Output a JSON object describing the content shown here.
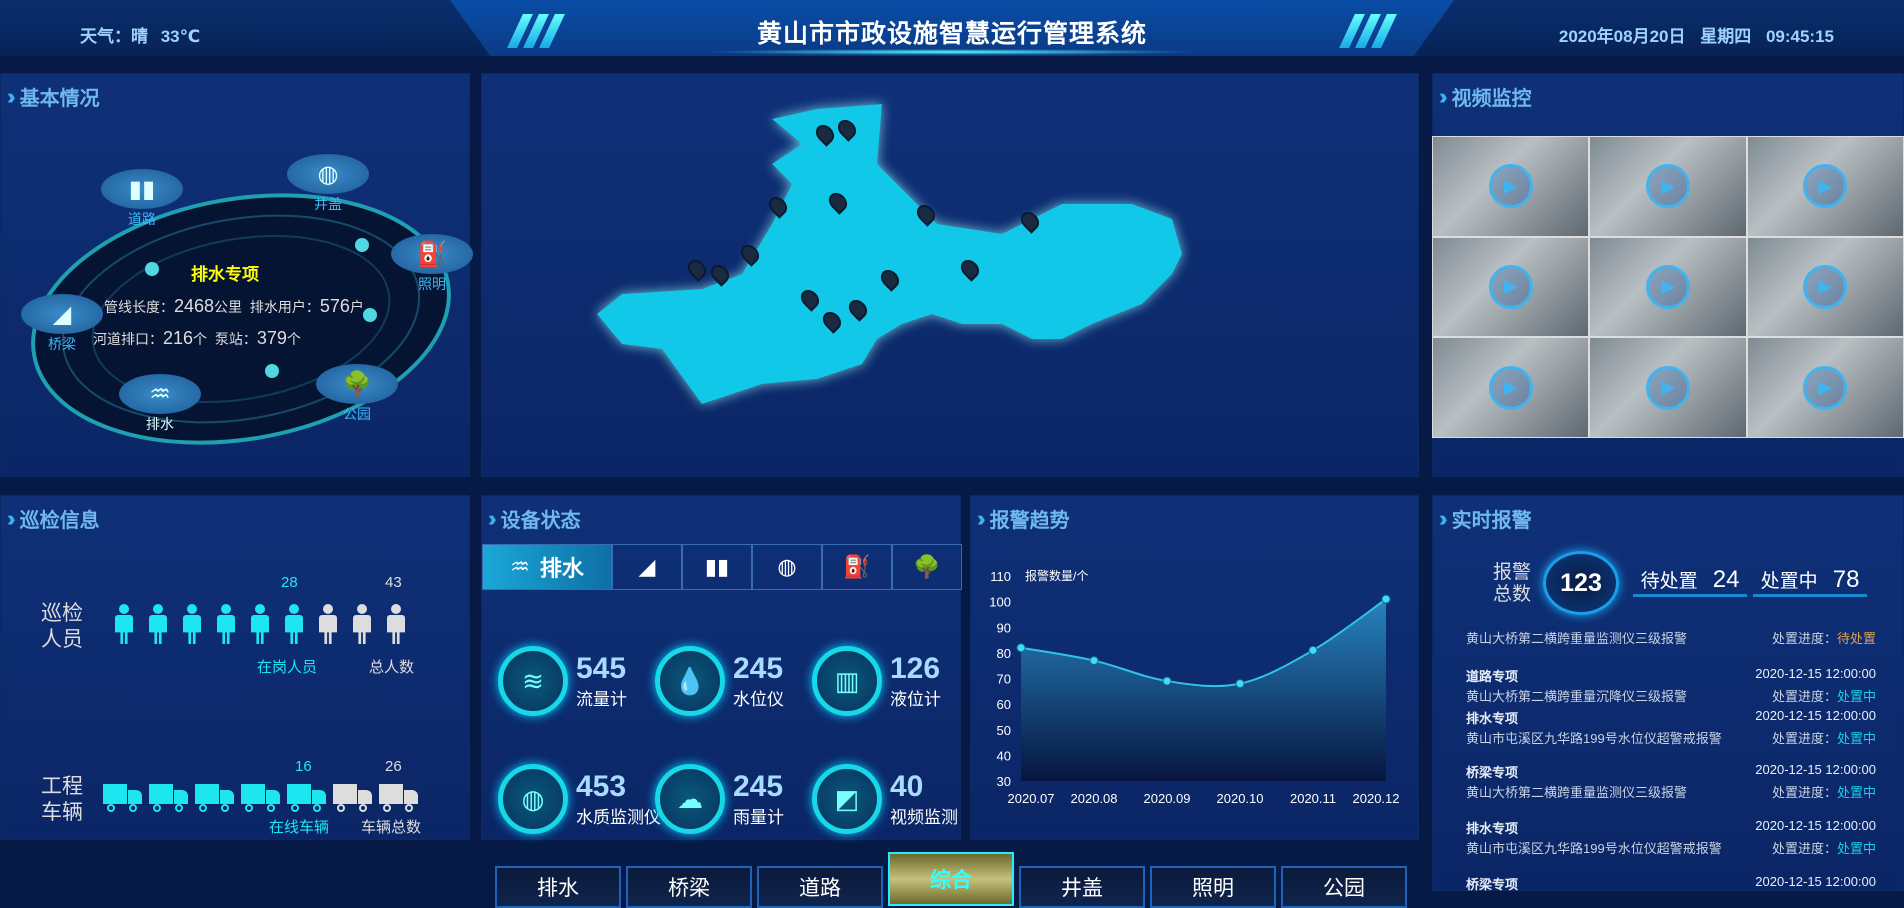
{
  "header": {
    "title": "黄山市市政设施智慧运行管理系统",
    "weather": "天气：晴 33℃",
    "datetime": "2020年08月20日 星期四 09:45:15"
  },
  "basic": {
    "title": "基本情况",
    "center_title": "排水专项",
    "stats": [
      {
        "label": "管线长度：",
        "value": "2468",
        "unit": "公里"
      },
      {
        "label": "排水用户：",
        "value": "576",
        "unit": "户"
      },
      {
        "label": "河道排口：",
        "value": "216",
        "unit": "个"
      },
      {
        "label": "泵站：",
        "value": "379",
        "unit": "个"
      }
    ],
    "nodes": [
      {
        "label": "道路",
        "icon": "road-icon"
      },
      {
        "label": "井盖",
        "icon": "manhole-icon"
      },
      {
        "label": "照明",
        "icon": "streetlight-icon"
      },
      {
        "label": "桥梁",
        "icon": "bridge-icon"
      },
      {
        "label": "排水",
        "icon": "drainage-icon"
      },
      {
        "label": "公园",
        "icon": "park-icon"
      }
    ]
  },
  "video": {
    "title": "视频监控",
    "tiles": 9
  },
  "patrol": {
    "title": "巡检信息",
    "personnel_label": "巡检人员",
    "on_duty": "28",
    "on_duty_label": "在岗人员",
    "total": "43",
    "total_label": "总人数",
    "vehicle_label": "工程车辆",
    "online": "16",
    "online_label": "在线车辆",
    "vehicle_total": "26",
    "vehicle_total_label": "车辆总数"
  },
  "devices": {
    "title": "设备状态",
    "active_tab": "排水",
    "metrics": [
      {
        "value": "545",
        "label": "流量计",
        "icon": "flow-meter-icon",
        "glyph": "≋"
      },
      {
        "value": "245",
        "label": "水位仪",
        "icon": "water-level-icon",
        "glyph": "💧"
      },
      {
        "value": "126",
        "label": "液位计",
        "icon": "liquid-level-icon",
        "glyph": "▥"
      },
      {
        "value": "453",
        "label": "水质监测仪",
        "icon": "water-quality-icon",
        "glyph": "◍"
      },
      {
        "value": "245",
        "label": "雨量计",
        "icon": "rain-gauge-icon",
        "glyph": "☁"
      },
      {
        "value": "40",
        "label": "视频监测",
        "icon": "camera-icon",
        "glyph": "◩"
      }
    ]
  },
  "trend": {
    "title": "报警趋势"
  },
  "chart_data": {
    "type": "area",
    "ylabel": "报警数量/个",
    "categories": [
      "2020.07",
      "2020.08",
      "2020.09",
      "2020.10",
      "2020.11",
      "2020.12"
    ],
    "values": [
      82,
      77,
      69,
      68,
      81,
      101
    ],
    "ylim": [
      30,
      110
    ],
    "yticks": [
      30,
      40,
      50,
      60,
      70,
      80,
      90,
      100,
      110
    ],
    "smooth": true,
    "color": "#2fc4e8"
  },
  "alarms": {
    "title": "实时报警",
    "total_label": "报警总数",
    "total": "123",
    "pending_label": "待处置",
    "pending": "24",
    "processing_label": "处置中",
    "processing": "78",
    "progress_label": "处置进度：",
    "items": [
      {
        "category": "",
        "time": "",
        "text": "黄山大桥第二横跨重量监测仪三级报警",
        "status": "待处置",
        "status_color": "#e0a050"
      },
      {
        "category": "道路专项",
        "time": "2020-12-15 12:00:00",
        "text": "黄山大桥第二横跨重量沉降仪三级报警",
        "status": "处置中",
        "status_color": "#18d0e8"
      },
      {
        "category": "排水专项",
        "time": "2020-12-15 12:00:00",
        "text": "黄山市屯溪区九华路199号水位仪超警戒报警",
        "status": "处置中",
        "status_color": "#18d0e8"
      },
      {
        "category": "桥梁专项",
        "time": "2020-12-15 12:00:00",
        "text": "黄山大桥第二横跨重量监测仪三级报警",
        "status": "处置中",
        "status_color": "#18d0e8"
      },
      {
        "category": "排水专项",
        "time": "2020-12-15 12:00:00",
        "text": "黄山市屯溪区九华路199号水位仪超警戒报警",
        "status": "处置中",
        "status_color": "#18d0e8"
      },
      {
        "category": "桥梁专项",
        "time": "2020-12-15 12:00:00",
        "text": "",
        "status": ""
      }
    ]
  },
  "bottom_tabs": [
    "排水",
    "桥梁",
    "道路",
    "综合",
    "井盖",
    "照明",
    "公园"
  ],
  "bottom_active": "综合"
}
